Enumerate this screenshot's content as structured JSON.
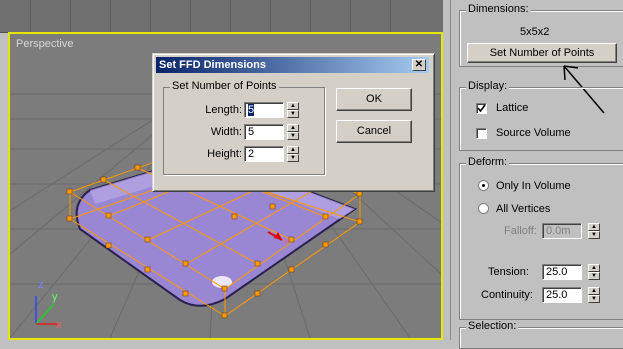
{
  "viewport": {
    "label": "Perspective"
  },
  "dialog": {
    "title": "Set FFD Dimensions",
    "close_glyph": "✕",
    "group_title": "Set Number of Points",
    "fields": [
      {
        "label": "Length:",
        "value": "5"
      },
      {
        "label": "Width:",
        "value": "5"
      },
      {
        "label": "Height:",
        "value": "2"
      }
    ],
    "ok_label": "OK",
    "cancel_label": "Cancel"
  },
  "panel": {
    "dimensions": {
      "title": "Dimensions:",
      "value": "5x5x2",
      "button_label": "Set Number of Points"
    },
    "display": {
      "title": "Display:",
      "lattice_label": "Lattice",
      "lattice_checked": true,
      "source_volume_label": "Source Volume",
      "source_volume_checked": false
    },
    "deform": {
      "title": "Deform:",
      "only_in_volume_label": "Only In Volume",
      "all_vertices_label": "All Vertices",
      "selected": "Only In Volume",
      "falloff_label": "Falloff:",
      "falloff_value": "0.0m"
    },
    "tension": {
      "label": "Tension:",
      "value": "25.0"
    },
    "continuity": {
      "label": "Continuity:",
      "value": "25.0"
    },
    "selection": {
      "title": "Selection:"
    }
  },
  "axes": {
    "x": "x",
    "y": "y",
    "z": "z"
  },
  "colors": {
    "lattice": "#ff9900",
    "object": "#9a87d4",
    "viewport_border": "#e6e600",
    "titlebar": "#0a246a"
  }
}
